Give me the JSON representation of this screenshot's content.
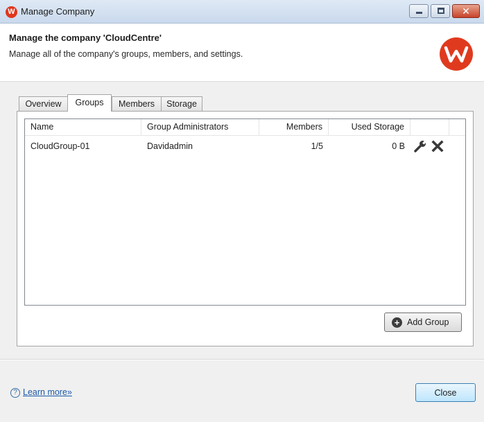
{
  "window": {
    "title": "Manage Company",
    "app_icon_letter": "W"
  },
  "header": {
    "title": "Manage the company 'CloudCentre'",
    "description": "Manage all of the company's groups, members, and settings.",
    "brand_color": "#e03a1e"
  },
  "tabs": [
    {
      "label": "Overview",
      "active": false
    },
    {
      "label": "Groups",
      "active": true
    },
    {
      "label": "Members",
      "active": false
    },
    {
      "label": "Storage",
      "active": false
    }
  ],
  "table": {
    "columns": [
      "Name",
      "Group Administrators",
      "Members",
      "Used Storage"
    ],
    "rows": [
      {
        "name": "CloudGroup-01",
        "admins": "Davidadmin",
        "members": "1/5",
        "storage": "0 B"
      }
    ]
  },
  "actions": {
    "add_group_label": "Add Group",
    "row_icons": [
      "wrench-icon",
      "delete-icon"
    ]
  },
  "footer": {
    "help_glyph": "?",
    "learn_more_label": "Learn more»",
    "close_label": "Close"
  }
}
